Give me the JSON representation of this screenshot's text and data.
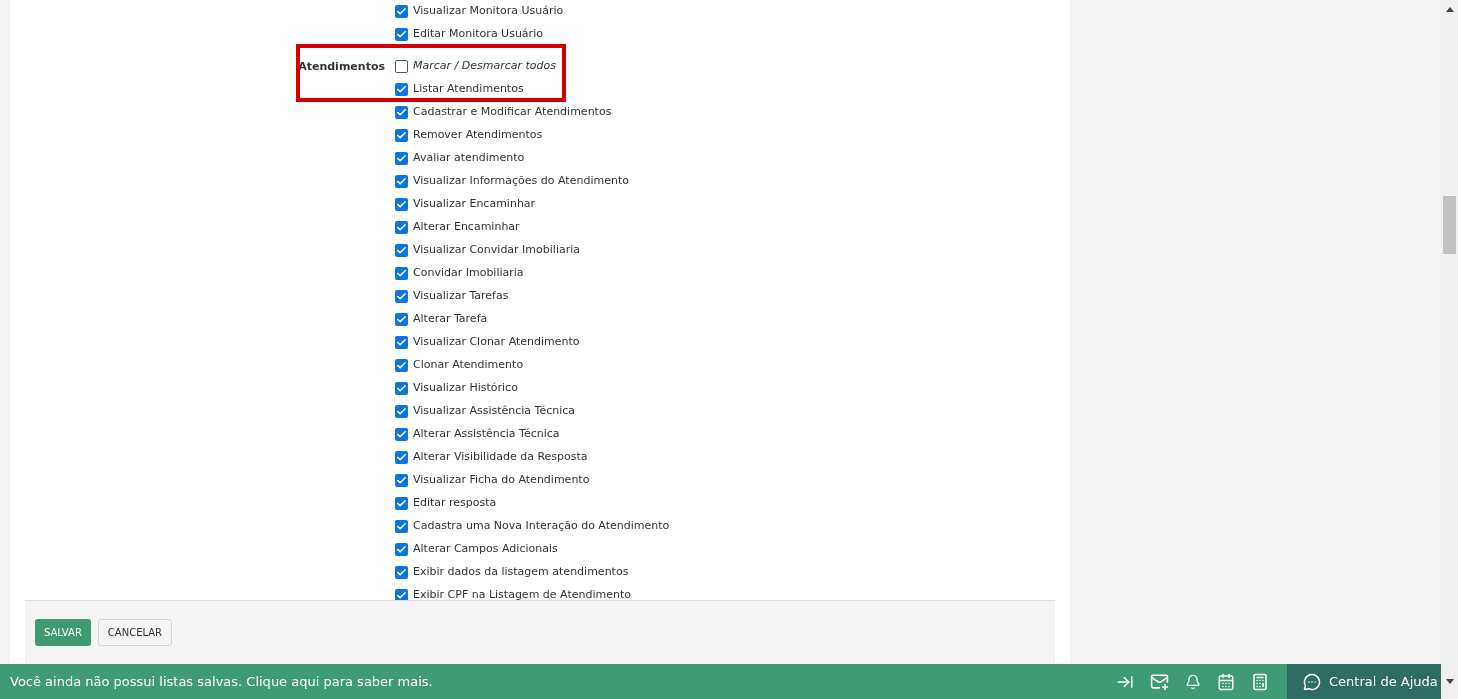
{
  "sections": [
    {
      "items": [
        {
          "kind": "permission",
          "label": "Visualizar Monitora Usuário",
          "checked": true
        },
        {
          "kind": "permission",
          "label": "Editar Monitora Usuário",
          "checked": true
        }
      ]
    },
    {
      "label": "Atendimentos",
      "highlighted": true,
      "items": [
        {
          "kind": "toggle_all",
          "label": "Marcar / Desmarcar todos",
          "checked": false
        },
        {
          "kind": "permission",
          "label": "Listar Atendimentos",
          "checked": true
        },
        {
          "kind": "permission",
          "label": "Cadastrar e Modificar Atendimentos",
          "checked": true
        },
        {
          "kind": "permission",
          "label": "Remover Atendimentos",
          "checked": true
        },
        {
          "kind": "permission",
          "label": "Avaliar atendimento",
          "checked": true
        },
        {
          "kind": "permission",
          "label": "Visualizar Informações do Atendimento",
          "checked": true
        },
        {
          "kind": "permission",
          "label": "Visualizar Encaminhar",
          "checked": true
        },
        {
          "kind": "permission",
          "label": "Alterar Encaminhar",
          "checked": true
        },
        {
          "kind": "permission",
          "label": "Visualizar Convidar Imobiliaria",
          "checked": true
        },
        {
          "kind": "permission",
          "label": "Convidar Imobiliaria",
          "checked": true
        },
        {
          "kind": "permission",
          "label": "Visualizar Tarefas",
          "checked": true
        },
        {
          "kind": "permission",
          "label": "Alterar Tarefa",
          "checked": true
        },
        {
          "kind": "permission",
          "label": "Visualizar Clonar Atendimento",
          "checked": true
        },
        {
          "kind": "permission",
          "label": "Clonar Atendimento",
          "checked": true
        },
        {
          "kind": "permission",
          "label": "Visualizar Histórico",
          "checked": true
        },
        {
          "kind": "permission",
          "label": "Visualizar Assistência Técnica",
          "checked": true
        },
        {
          "kind": "permission",
          "label": "Alterar Assistência Técnica",
          "checked": true
        },
        {
          "kind": "permission",
          "label": "Alterar Visibilidade da Resposta",
          "checked": true
        },
        {
          "kind": "permission",
          "label": "Visualizar Ficha do Atendimento",
          "checked": true
        },
        {
          "kind": "permission",
          "label": "Editar resposta",
          "checked": true
        },
        {
          "kind": "permission",
          "label": "Cadastra uma Nova Interação do Atendimento",
          "checked": true
        },
        {
          "kind": "permission",
          "label": "Alterar Campos Adicionais",
          "checked": true
        },
        {
          "kind": "permission",
          "label": "Exibir dados da listagem atendimentos",
          "checked": true
        },
        {
          "kind": "permission",
          "label": "Exibir CPF na Listagem de Atendimento",
          "checked": true
        }
      ]
    }
  ],
  "form_actions": [
    {
      "kind": "primary",
      "label": "SALVAR"
    },
    {
      "kind": "secondary",
      "label": "CANCELAR"
    }
  ],
  "status_bar": {
    "message": "Você ainda não possui listas salvas. Clique aqui para saber mais.",
    "help_button": "Central de Ajuda"
  }
}
